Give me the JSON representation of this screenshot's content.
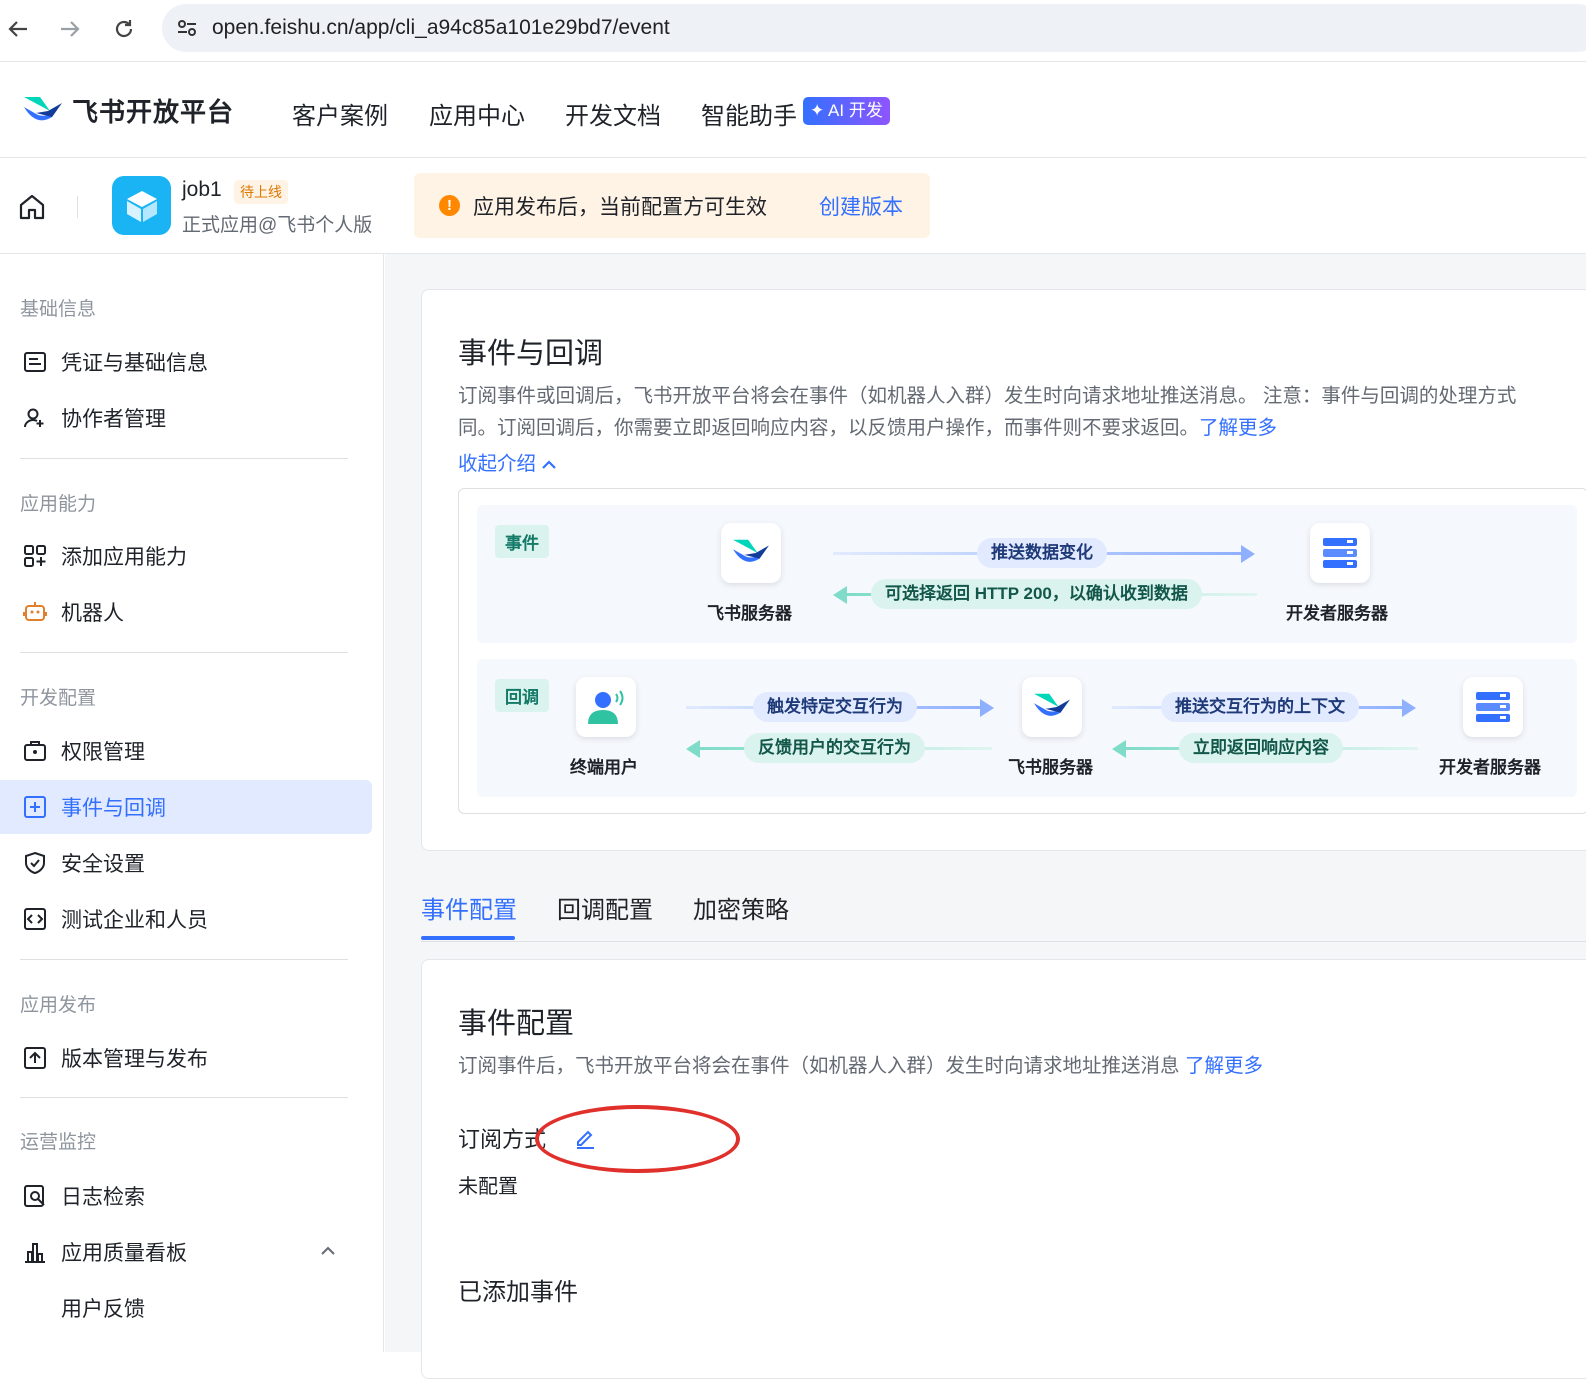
{
  "browser": {
    "url": "open.feishu.cn/app/cli_a94c85a101e29bd7/event"
  },
  "topnav": {
    "brand": "飞书开放平台",
    "items": [
      "客户案例",
      "应用中心",
      "开发文档",
      "智能助手"
    ],
    "ai_badge": "AI 开发"
  },
  "app": {
    "name": "job1",
    "status": "待上线",
    "subtitle": "正式应用@飞书个人版",
    "notice": "应用发布后，当前配置方可生效",
    "notice_link": "创建版本"
  },
  "sidebar": {
    "groups": {
      "basic": "基础信息",
      "ability": "应用能力",
      "dev": "开发配置",
      "publish": "应用发布",
      "ops": "运营监控"
    },
    "items": {
      "credentials": "凭证与基础信息",
      "collaborators": "协作者管理",
      "add_ability": "添加应用能力",
      "bot": "机器人",
      "permissions": "权限管理",
      "events": "事件与回调",
      "security": "安全设置",
      "test_org": "测试企业和人员",
      "versions": "版本管理与发布",
      "log_search": "日志检索",
      "quality": "应用质量看板",
      "feedback": "用户反馈"
    }
  },
  "intro": {
    "title": "事件与回调",
    "desc_line1": "订阅事件或回调后，飞书开放平台将会在事件（如机器人入群）发生时向请求地址推送消息。 注意：事件与回调的处理方式",
    "desc_line2": "同。订阅回调后，你需要立即返回响应内容，以反馈用户操作，而事件则不要求返回。",
    "learn_more": "了解更多",
    "collapse": "收起介绍"
  },
  "flow": {
    "event": {
      "tag": "事件",
      "from": "飞书服务器",
      "to": "开发者服务器",
      "push": "推送数据变化",
      "ack": "可选择返回 HTTP 200，以确认收到数据"
    },
    "callback": {
      "tag": "回调",
      "user": "终端用户",
      "server": "飞书服务器",
      "dev": "开发者服务器",
      "trigger": "触发特定交互行为",
      "feedback": "反馈用户的交互行为",
      "push_context": "推送交互行为的上下文",
      "respond": "立即返回响应内容"
    }
  },
  "tabs": [
    "事件配置",
    "回调配置",
    "加密策略"
  ],
  "event_config": {
    "title": "事件配置",
    "desc": "订阅事件后，飞书开放平台将会在事件（如机器人入群）发生时向请求地址推送消息",
    "learn_more": "了解更多",
    "subscribe_label": "订阅方式",
    "subscribe_value": "未配置",
    "added_events": "已添加事件"
  },
  "colors": {
    "accent": "#3370ff",
    "active_bg": "#e1eaff",
    "notice_bg": "#fff3e5",
    "annotation": "#e0302b"
  }
}
